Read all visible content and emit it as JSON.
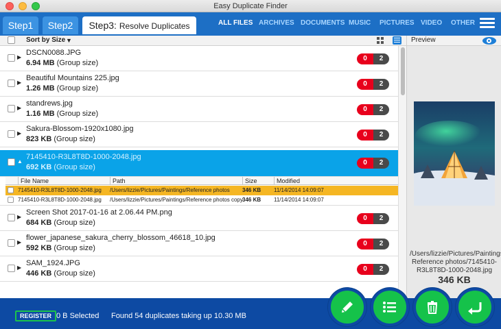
{
  "window": {
    "title": "Easy Duplicate Finder"
  },
  "header": {
    "steps": [
      {
        "label": "Step1"
      },
      {
        "label": "Step2"
      },
      {
        "label": "Step3:",
        "sub": "Resolve Duplicates"
      }
    ],
    "categories": [
      "ALL FILES",
      "ARCHIVES",
      "DOCUMENTS",
      "MUSIC",
      "PICTURES",
      "VIDEO",
      "OTHER"
    ]
  },
  "toolbar": {
    "sort_label": "Sort by Size",
    "sort_arrow": "▼"
  },
  "groups": [
    {
      "name": "DSCN0088.JPG",
      "size": "6.94 MB",
      "size_note": "(Group size)",
      "left": "0",
      "right": "2"
    },
    {
      "name": "Beautiful Mountains 225.jpg",
      "size": "1.26 MB",
      "size_note": "(Group size)",
      "left": "0",
      "right": "2"
    },
    {
      "name": "standrews.jpg",
      "size": "1.16 MB",
      "size_note": "(Group size)",
      "left": "0",
      "right": "2"
    },
    {
      "name": "Sakura-Blossom-1920x1080.jpg",
      "size": "823 KB",
      "size_note": "(Group size)",
      "left": "0",
      "right": "2"
    },
    {
      "name": "7145410-R3L8T8D-1000-2048.jpg",
      "size": "692 KB",
      "size_note": "(Group size)",
      "left": "0",
      "right": "2"
    },
    {
      "name": "Screen Shot 2017-01-16 at 2.06.44 PM.png",
      "size": "684 KB",
      "size_note": "(Group size)",
      "left": "0",
      "right": "2"
    },
    {
      "name": "flower_japanese_sakura_cherry_blossom_46618_10.jpg",
      "size": "592 KB",
      "size_note": "(Group size)",
      "left": "0",
      "right": "2"
    },
    {
      "name": "SAM_1924.JPG",
      "size": "446 KB",
      "size_note": "(Group size)",
      "left": "0",
      "right": "2"
    }
  ],
  "subtable": {
    "headers": {
      "file_name": "File Name",
      "path": "Path",
      "size": "Size",
      "modified": "Modified"
    },
    "rows": [
      {
        "file_name": "7145410-R3L8T8D-1000-2048.jpg",
        "path": "/Users/lizzie/Pictures/Paintings/Reference photos",
        "size": "346 KB",
        "modified": "11/14/2014 14:09:07"
      },
      {
        "file_name": "7145410-R3L8T8D-1000-2048.jpg",
        "path": "/Users/lizzie/Pictures/Paintings/Reference photos copy",
        "size": "346 KB",
        "modified": "11/14/2014 14:09:07"
      }
    ]
  },
  "preview": {
    "label": "Preview",
    "path_lines": [
      "/Users/lizzie/Pictures/Paintings/",
      "Reference photos/7145410-",
      "R3L8T8D-1000-2048.jpg"
    ],
    "size": "346 KB"
  },
  "footer": {
    "register_label": "REGISTER",
    "selected_text": "0 B Selected",
    "found_text": "Found 54 duplicates taking up 10.30 MB"
  },
  "actions": [
    "pencil-icon",
    "list-icon",
    "trash-icon",
    "undo-icon"
  ],
  "colors": {
    "header": "#1d6fc5",
    "footer": "#0d4aa3",
    "selected_row": "#0aa3e8",
    "highlight_row": "#f5b623",
    "fab": "#15c24a",
    "pill_red": "#e8001c"
  }
}
